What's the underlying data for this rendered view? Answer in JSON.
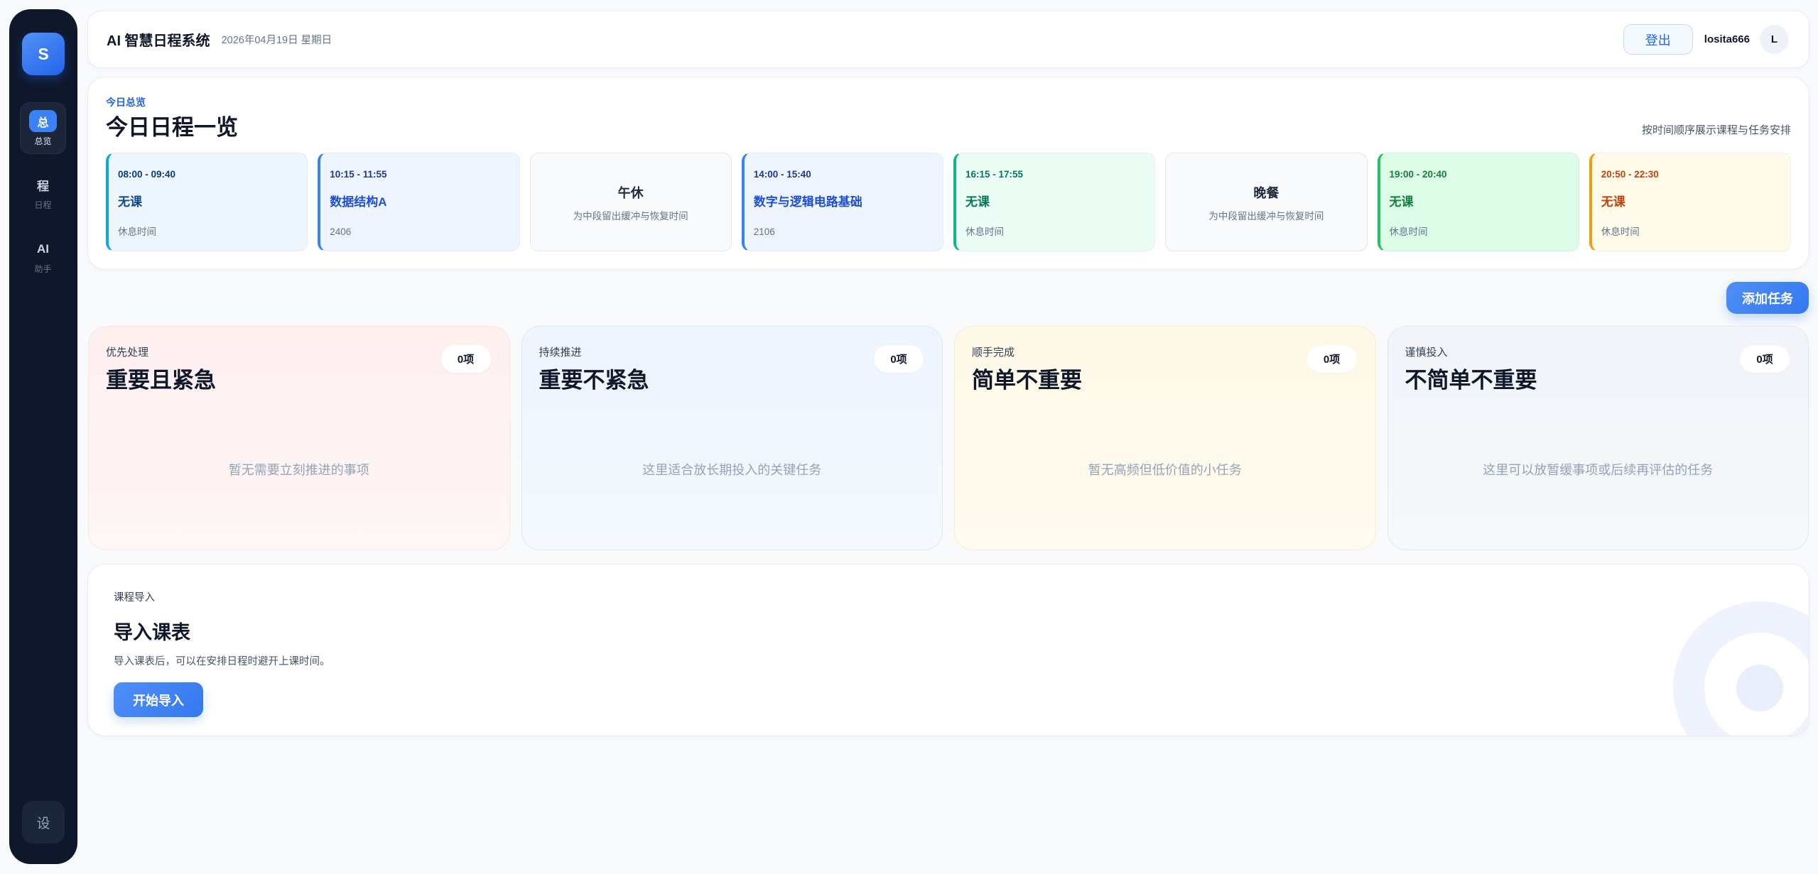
{
  "app": {
    "title": "AI 智慧日程系统",
    "date": "2026年04月19日 星期日"
  },
  "colors": {
    "page": "#f8fafc",
    "sidebar": "#0f172a",
    "brand": "#3b82f6",
    "brand_dark": "#2563eb"
  },
  "sidebar": {
    "logo": "S",
    "items": [
      {
        "glyph": "总",
        "label": "总览"
      },
      {
        "glyph": "程",
        "label": "日程"
      },
      {
        "glyph": "AI",
        "label": "助手"
      }
    ],
    "settings": "设"
  },
  "header": {
    "logout_label": "登出",
    "username": "losita666",
    "avatar_initial": "L"
  },
  "overview": {
    "eyebrow": "今日总览",
    "title": "今日日程一览",
    "hint": "按时间顺序展示课程与任务安排",
    "slots": [
      {
        "time": "08:00 - 09:40",
        "title": "无课",
        "sub": "休息时间",
        "accent": "#0ea5e9",
        "bg": "#eef6fd",
        "time_color": "#0b3b7a",
        "title_color": "#0c4a8a"
      },
      {
        "time": "10:15 - 11:55",
        "title": "数据结构A",
        "sub": "2406",
        "accent": "#3b82f6",
        "bg": "#eef5ff",
        "time_color": "#1e3a8a",
        "title_color": "#1d4ed8"
      },
      {
        "title": "午休",
        "sub": "为中段留出缓冲与恢复时间"
      },
      {
        "time": "14:00 - 15:40",
        "title": "数字与逻辑电路基础",
        "sub": "2106",
        "accent": "#3b82f6",
        "bg": "#eef5ff",
        "time_color": "#1e3a8a",
        "title_color": "#1d4ed8"
      },
      {
        "time": "16:15 - 17:55",
        "title": "无课",
        "sub": "休息时间",
        "accent": "#10b981",
        "bg": "#ecfdf5",
        "time_color": "#047857",
        "title_color": "#047857"
      },
      {
        "title": "晚餐",
        "sub": "为中段留出缓冲与恢复时间"
      },
      {
        "time": "19:00 - 20:40",
        "title": "无课",
        "sub": "休息时间",
        "accent": "#22c55e",
        "bg": "#dcfce7",
        "time_color": "#15803d",
        "title_color": "#15803d"
      },
      {
        "time": "20:50 - 22:30",
        "title": "无课",
        "sub": "休息时间",
        "accent": "#f59e0b",
        "bg": "#fffbeb",
        "time_color": "#c2410c",
        "title_color": "#c2410c"
      }
    ]
  },
  "actions": {
    "add_task_label": "添加任务"
  },
  "quadrants": [
    {
      "eyebrow": "优先处理",
      "title": "重要且紧急",
      "count": "0项",
      "empty": "暂无需要立刻推进的事项",
      "bg_top": "#fff0f0",
      "bg_bottom": "#fff6f6",
      "border": "#fde3e3"
    },
    {
      "eyebrow": "持续推进",
      "title": "重要不紧急",
      "count": "0项",
      "empty": "这里适合放长期投入的关键任务",
      "bg_top": "#eef5ff",
      "bg_bottom": "#f5f9ff",
      "border": "#dbe8fb"
    },
    {
      "eyebrow": "顺手完成",
      "title": "简单不重要",
      "count": "0项",
      "empty": "暂无高频但低价值的小任务",
      "bg_top": "#fef8e6",
      "bg_bottom": "#fffbf0",
      "border": "#f9eccb"
    },
    {
      "eyebrow": "谨慎投入",
      "title": "不简单不重要",
      "count": "0项",
      "empty": "这里可以放暂缓事项或后续再评估的任务",
      "bg_top": "#f1f4f9",
      "bg_bottom": "#f6f8fb",
      "border": "#e3e8f0"
    }
  ],
  "import": {
    "eyebrow": "课程导入",
    "title": "导入课表",
    "desc": "导入课表后，可以在安排日程时避开上课时间。",
    "button_label": "开始导入"
  }
}
